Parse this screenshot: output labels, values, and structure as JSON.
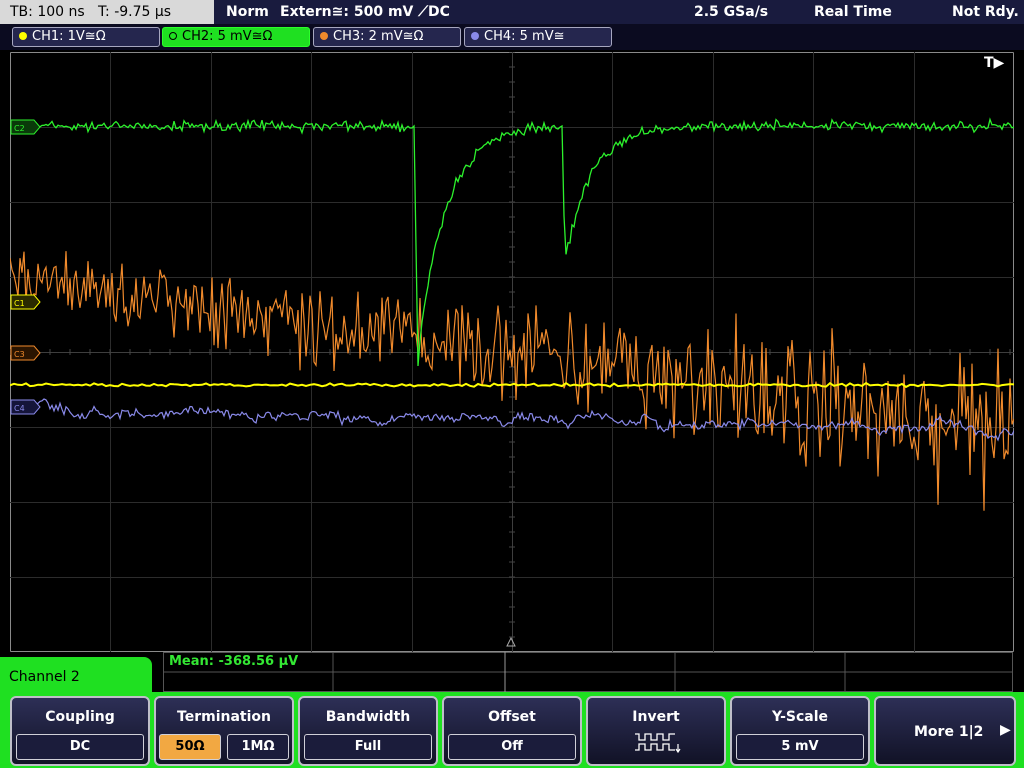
{
  "topbar": {
    "timebase": "TB: 100 ns",
    "trigger_time": "T: -9.75 μs",
    "mode": "Norm",
    "trigger_source": "Extern≅: 500 mV ⟋DC",
    "sample_rate": "2.5 GSa/s",
    "acquisition": "Real Time",
    "status": "Not Rdy."
  },
  "channels": [
    {
      "label": "CH1: 1V≅Ω",
      "color": "#ffff00",
      "active": false
    },
    {
      "label": "CH2: 5 mV≅Ω",
      "color": "#2cf22c",
      "active": true
    },
    {
      "label": "CH3: 2 mV≅Ω",
      "color": "#f08a2c",
      "active": false
    },
    {
      "label": "CH4: 5 mV≅",
      "color": "#8a8aea",
      "active": false
    }
  ],
  "grid": {
    "trigger_marker": "T▶",
    "markers": {
      "ch1": "C1",
      "ch2": "C2",
      "ch3": "C3",
      "ch4": "C4"
    }
  },
  "measurement": {
    "mean": "Mean: -368.56 μV"
  },
  "menu": {
    "title": "Channel 2",
    "coupling": {
      "title": "Coupling",
      "value": "DC"
    },
    "termination": {
      "title": "Termination",
      "option1": "50Ω",
      "option2": "1MΩ",
      "selected": "50Ω"
    },
    "bandwidth": {
      "title": "Bandwidth",
      "value": "Full"
    },
    "offset": {
      "title": "Offset",
      "value": "Off"
    },
    "invert": {
      "title": "Invert"
    },
    "yscale": {
      "title": "Y-Scale",
      "value": "5 mV"
    },
    "more": {
      "label": "More 1|2"
    }
  },
  "colors": {
    "accent": "#1fe021",
    "ch1": "#ffff00",
    "ch2": "#2cf22c",
    "ch3": "#f08a2c",
    "ch4": "#8a8aea"
  }
}
